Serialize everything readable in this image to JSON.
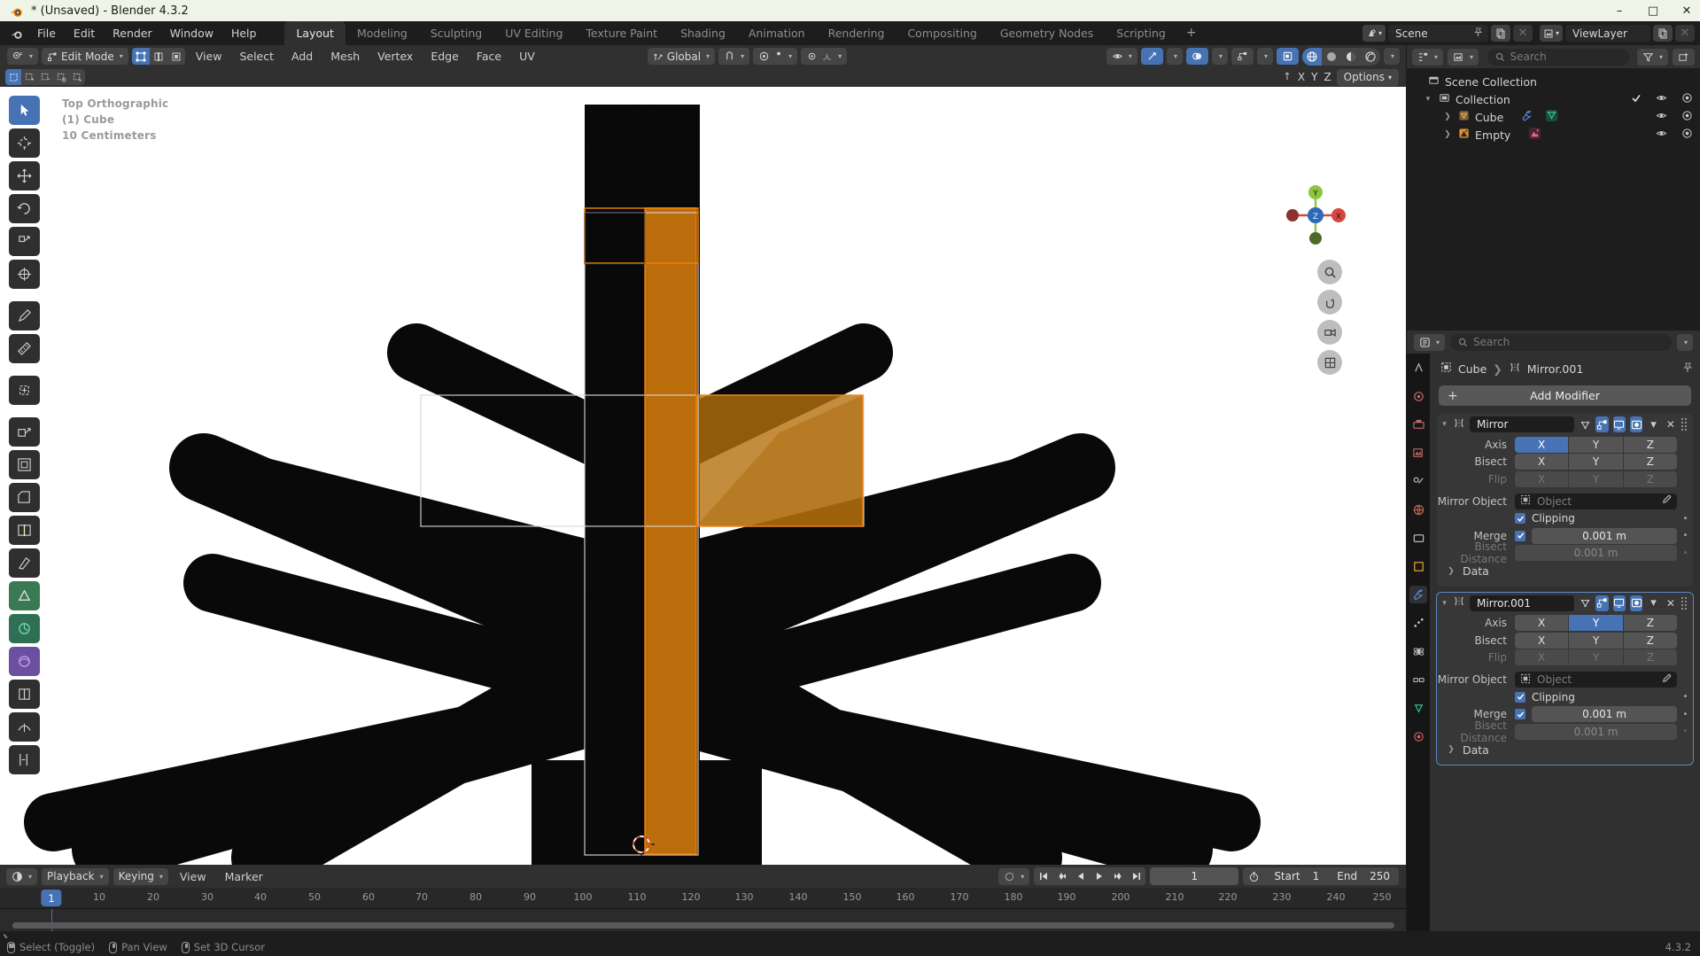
{
  "window": {
    "title": "* (Unsaved) - Blender 4.3.2",
    "minimize": "–",
    "maximize": "□",
    "close": "✕"
  },
  "topbar": {
    "menus": [
      "File",
      "Edit",
      "Render",
      "Window",
      "Help"
    ],
    "workspaces": [
      {
        "label": "Layout",
        "active": true
      },
      {
        "label": "Modeling",
        "active": false
      },
      {
        "label": "Sculpting",
        "active": false
      },
      {
        "label": "UV Editing",
        "active": false
      },
      {
        "label": "Texture Paint",
        "active": false
      },
      {
        "label": "Shading",
        "active": false
      },
      {
        "label": "Animation",
        "active": false
      },
      {
        "label": "Rendering",
        "active": false
      },
      {
        "label": "Compositing",
        "active": false
      },
      {
        "label": "Geometry Nodes",
        "active": false
      },
      {
        "label": "Scripting",
        "active": false
      }
    ],
    "add_workspace": "+",
    "scene_name": "Scene",
    "viewlayer_name": "ViewLayer"
  },
  "viewport_header": {
    "mode": "Edit Mode",
    "menus": [
      "View",
      "Select",
      "Add",
      "Mesh",
      "Vertex",
      "Edge",
      "Face",
      "UV"
    ],
    "transform_orientation": "Global",
    "options_label": "Options",
    "xyz": [
      "X",
      "Y",
      "Z"
    ]
  },
  "viewport": {
    "view_name": "Top Orthographic",
    "object_line": "(1) Cube",
    "grid_scale": "10 Centimeters",
    "gizmo_axes": {
      "x": "X",
      "y": "Y",
      "z": "Z"
    }
  },
  "outliner": {
    "search_placeholder": "Search",
    "rows": [
      {
        "label": "Scene Collection",
        "icon": "collection-icon",
        "indent": 0,
        "expandable": false
      },
      {
        "label": "Collection",
        "icon": "collection-icon",
        "indent": 1,
        "expandable": true
      },
      {
        "label": "Cube",
        "icon": "mesh-object-icon",
        "indent": 2,
        "expandable": true
      },
      {
        "label": "Empty",
        "icon": "empty-object-icon",
        "indent": 2,
        "expandable": true
      }
    ]
  },
  "properties": {
    "search_placeholder": "Search",
    "breadcrumb": [
      "Cube",
      "Mirror.001"
    ],
    "add_modifier_label": "Add Modifier",
    "modifiers": [
      {
        "name": "Mirror",
        "selected": false,
        "labels": {
          "axis": "Axis",
          "bisect": "Bisect",
          "flip": "Flip",
          "mirror_object": "Mirror Object",
          "clipping": "Clipping",
          "merge": "Merge",
          "bisect_distance": "Bisect Distance",
          "data": "Data"
        },
        "axis": {
          "options": [
            "X",
            "Y",
            "Z"
          ],
          "active": [
            "X"
          ]
        },
        "bisect": {
          "options": [
            "X",
            "Y",
            "Z"
          ],
          "active": []
        },
        "flip": {
          "options": [
            "X",
            "Y",
            "Z"
          ],
          "active": [],
          "disabled": true
        },
        "mirror_object_placeholder": "Object",
        "clipping_checked": true,
        "merge_checked": true,
        "merge_value": "0.001 m",
        "bisect_distance_value": "0.001 m"
      },
      {
        "name": "Mirror.001",
        "selected": true,
        "labels": {
          "axis": "Axis",
          "bisect": "Bisect",
          "flip": "Flip",
          "mirror_object": "Mirror Object",
          "clipping": "Clipping",
          "merge": "Merge",
          "bisect_distance": "Bisect Distance",
          "data": "Data"
        },
        "axis": {
          "options": [
            "X",
            "Y",
            "Z"
          ],
          "active": [
            "Y"
          ]
        },
        "bisect": {
          "options": [
            "X",
            "Y",
            "Z"
          ],
          "active": []
        },
        "flip": {
          "options": [
            "X",
            "Y",
            "Z"
          ],
          "active": [],
          "disabled": true
        },
        "mirror_object_placeholder": "Object",
        "clipping_checked": true,
        "merge_checked": true,
        "merge_value": "0.001 m",
        "bisect_distance_value": "0.001 m"
      }
    ]
  },
  "timeline": {
    "menus": [
      "Playback",
      "Keying",
      "View",
      "Marker"
    ],
    "current_frame": "1",
    "start_label": "Start",
    "start_value": "1",
    "end_label": "End",
    "end_value": "250",
    "playhead_label": "1",
    "ticks": [
      "10",
      "20",
      "30",
      "40",
      "50",
      "60",
      "70",
      "80",
      "90",
      "100",
      "110",
      "120",
      "130",
      "140",
      "150",
      "160",
      "170",
      "180",
      "190",
      "200",
      "210",
      "220",
      "230",
      "240",
      "250"
    ]
  },
  "statusbar": {
    "items": [
      {
        "label": "Select (Toggle)",
        "mouse": "left"
      },
      {
        "label": "Pan View",
        "mouse": "middle"
      },
      {
        "label": "Set 3D Cursor",
        "mouse": "right"
      }
    ],
    "version": "4.3.2"
  },
  "colors": {
    "accent_blue": "#4772b3",
    "selected_orange": "#e8860c",
    "panel_bg": "#303030",
    "window_bg": "#1d1d1d",
    "viewport_bg": "#ffffff",
    "mesh_black": "#0b0b0b"
  }
}
